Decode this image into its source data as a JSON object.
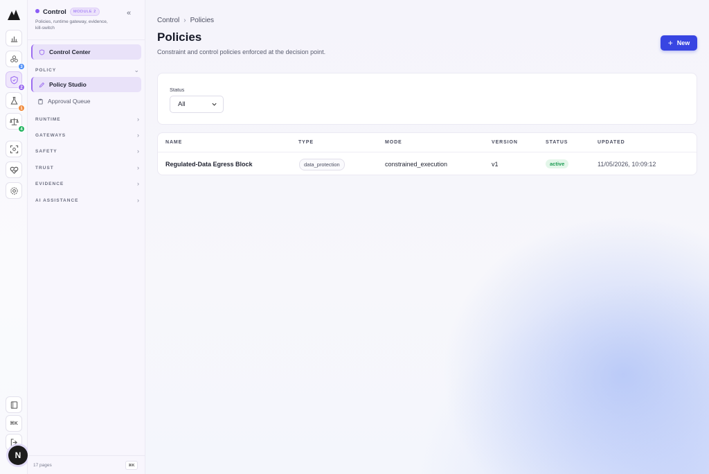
{
  "rail": {
    "badges": {
      "workflows": "3",
      "control": "2",
      "lab": "1",
      "compliance": "4"
    },
    "kbd_button": "⌘K",
    "avatar_initial": "N",
    "colors": {
      "workflows": "#4f8ff7",
      "control": "#9b6cf0",
      "lab": "#f08a3c",
      "compliance": "#22b35e"
    }
  },
  "sidebar": {
    "module_name": "Control",
    "module_tag": "MODULE 2",
    "module_desc": "Policies, runtime gateway, evidence, kill-switch",
    "collapse_icon": "«",
    "control_center": "Control Center",
    "sections": {
      "policy": "POLICY",
      "runtime": "RUNTIME",
      "gateways": "GATEWAYS",
      "safety": "SAFETY",
      "trust": "TRUST",
      "evidence": "EVIDENCE",
      "ai_assistance": "AI ASSISTANCE"
    },
    "policy_items": {
      "policy_studio": "Policy Studio",
      "approval_queue": "Approval Queue"
    },
    "footer_pages": "17 pages",
    "footer_kbd": "⌘K"
  },
  "header": {
    "breadcrumb": [
      "Control",
      "Policies"
    ],
    "breadcrumb_sep": "›",
    "title": "Policies",
    "subtitle": "Constraint and control policies enforced at the decision point.",
    "new_button_label": "New",
    "new_button_icon": "+"
  },
  "filter": {
    "label": "Status",
    "value": "All"
  },
  "table": {
    "columns": [
      "NAME",
      "TYPE",
      "MODE",
      "VERSION",
      "STATUS",
      "UPDATED"
    ],
    "rows": [
      {
        "name": "Regulated-Data Egress Block",
        "type": "data_protection",
        "mode": "constrained_execution",
        "version": "v1",
        "status": "active",
        "updated": "11/05/2026, 10:09:12"
      }
    ]
  },
  "colors": {
    "accent": "#3845e2",
    "active_status": "#1f9d55",
    "module_purple": "#8b5cf6"
  }
}
